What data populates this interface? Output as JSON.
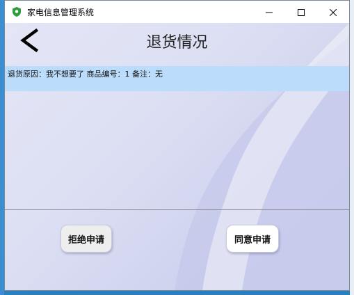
{
  "window": {
    "title": "家电信息管理系统",
    "controls": {
      "minimize": "minimize-icon",
      "maximize": "maximize-icon",
      "close": "close-icon"
    }
  },
  "page": {
    "back_icon": "chevron-left-icon",
    "title": "退货情况"
  },
  "returns_list": {
    "items": [
      {
        "text": "退货原因：我不想要了 商品编号：1 备注：无"
      }
    ]
  },
  "actions": {
    "reject_label": "拒绝申请",
    "approve_label": "同意申请"
  },
  "colors": {
    "selected_row": "#bcdcfb",
    "background": "#dcdff3",
    "app_icon": "#2e9c3a"
  }
}
